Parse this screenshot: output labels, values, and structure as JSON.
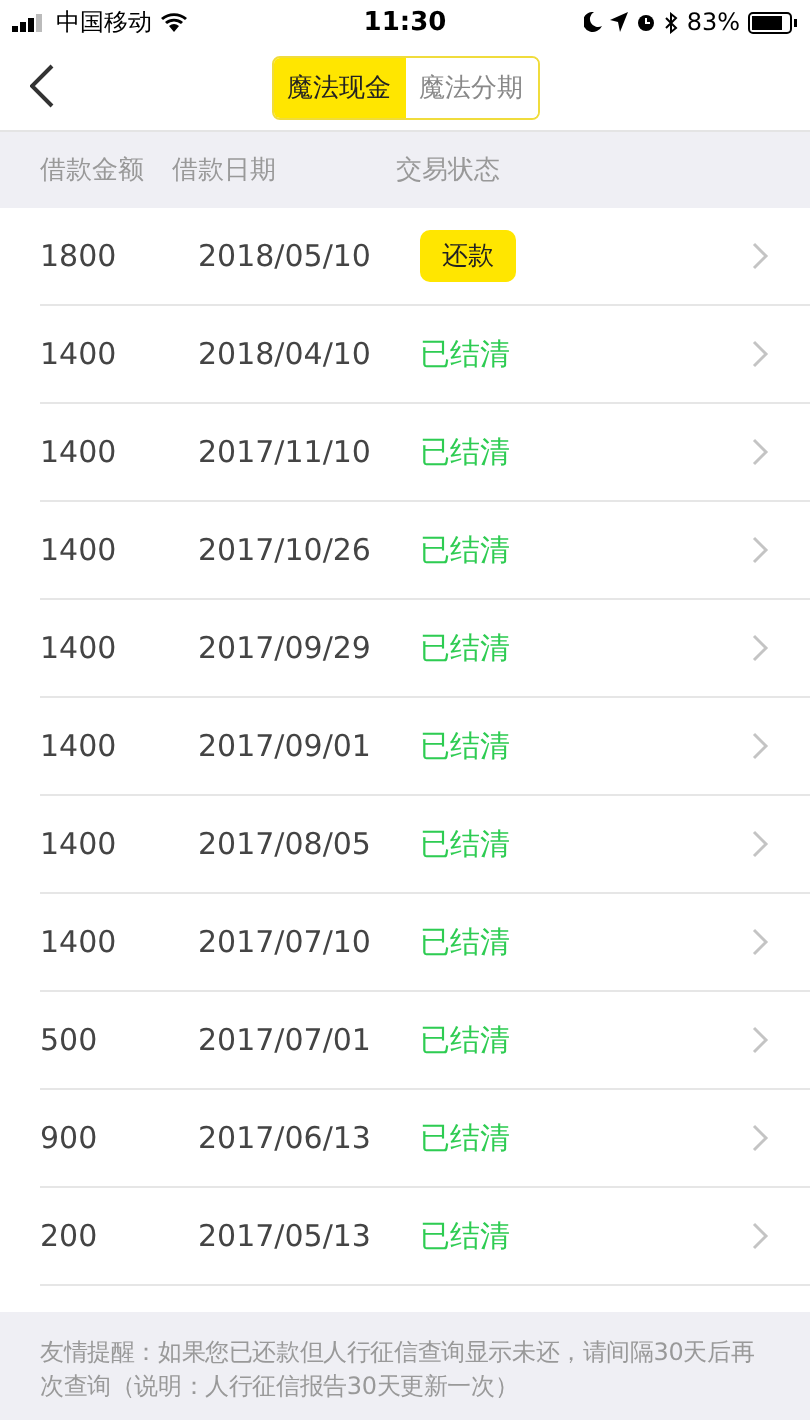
{
  "status_bar": {
    "carrier": "中国移动",
    "time": "11:30",
    "battery": "83%"
  },
  "tabs": [
    {
      "label": "魔法现金",
      "selected": true
    },
    {
      "label": "魔法分期",
      "selected": false
    }
  ],
  "table": {
    "columns": [
      "借款金额",
      "借款日期",
      "交易状态"
    ],
    "rows": [
      {
        "amount": "1800",
        "date": "2018/05/10",
        "status": "还款",
        "kind": "button"
      },
      {
        "amount": "1400",
        "date": "2018/04/10",
        "status": "已结清",
        "kind": "text"
      },
      {
        "amount": "1400",
        "date": "2017/11/10",
        "status": "已结清",
        "kind": "text"
      },
      {
        "amount": "1400",
        "date": "2017/10/26",
        "status": "已结清",
        "kind": "text"
      },
      {
        "amount": "1400",
        "date": "2017/09/29",
        "status": "已结清",
        "kind": "text"
      },
      {
        "amount": "1400",
        "date": "2017/09/01",
        "status": "已结清",
        "kind": "text"
      },
      {
        "amount": "1400",
        "date": "2017/08/05",
        "status": "已结清",
        "kind": "text"
      },
      {
        "amount": "1400",
        "date": "2017/07/10",
        "status": "已结清",
        "kind": "text"
      },
      {
        "amount": "500",
        "date": "2017/07/01",
        "status": "已结清",
        "kind": "text"
      },
      {
        "amount": "900",
        "date": "2017/06/13",
        "status": "已结清",
        "kind": "text"
      },
      {
        "amount": "200",
        "date": "2017/05/13",
        "status": "已结清",
        "kind": "text"
      }
    ]
  },
  "footer_note": "友情提醒：如果您已还款但人行征信查询显示未还，请间隔30天后再次查询（说明：人行征信报告30天更新一次）"
}
